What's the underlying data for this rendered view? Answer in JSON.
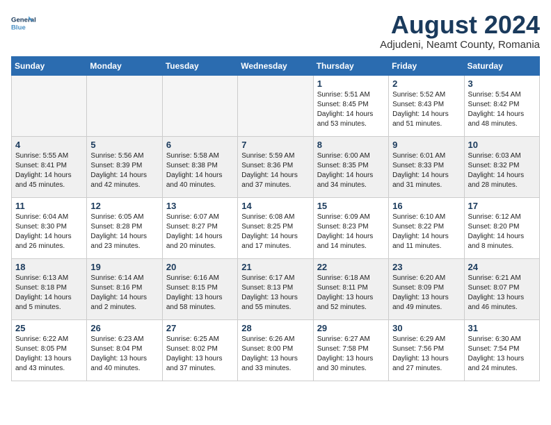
{
  "header": {
    "logo_line1": "General",
    "logo_line2": "Blue",
    "month_year": "August 2024",
    "location": "Adjudeni, Neamt County, Romania"
  },
  "days_of_week": [
    "Sunday",
    "Monday",
    "Tuesday",
    "Wednesday",
    "Thursday",
    "Friday",
    "Saturday"
  ],
  "weeks": [
    [
      {
        "day": "",
        "text": "",
        "empty": true
      },
      {
        "day": "",
        "text": "",
        "empty": true
      },
      {
        "day": "",
        "text": "",
        "empty": true
      },
      {
        "day": "",
        "text": "",
        "empty": true
      },
      {
        "day": "1",
        "text": "Sunrise: 5:51 AM\nSunset: 8:45 PM\nDaylight: 14 hours\nand 53 minutes."
      },
      {
        "day": "2",
        "text": "Sunrise: 5:52 AM\nSunset: 8:43 PM\nDaylight: 14 hours\nand 51 minutes."
      },
      {
        "day": "3",
        "text": "Sunrise: 5:54 AM\nSunset: 8:42 PM\nDaylight: 14 hours\nand 48 minutes."
      }
    ],
    [
      {
        "day": "4",
        "text": "Sunrise: 5:55 AM\nSunset: 8:41 PM\nDaylight: 14 hours\nand 45 minutes.",
        "shaded": true
      },
      {
        "day": "5",
        "text": "Sunrise: 5:56 AM\nSunset: 8:39 PM\nDaylight: 14 hours\nand 42 minutes.",
        "shaded": true
      },
      {
        "day": "6",
        "text": "Sunrise: 5:58 AM\nSunset: 8:38 PM\nDaylight: 14 hours\nand 40 minutes.",
        "shaded": true
      },
      {
        "day": "7",
        "text": "Sunrise: 5:59 AM\nSunset: 8:36 PM\nDaylight: 14 hours\nand 37 minutes.",
        "shaded": true
      },
      {
        "day": "8",
        "text": "Sunrise: 6:00 AM\nSunset: 8:35 PM\nDaylight: 14 hours\nand 34 minutes.",
        "shaded": true
      },
      {
        "day": "9",
        "text": "Sunrise: 6:01 AM\nSunset: 8:33 PM\nDaylight: 14 hours\nand 31 minutes.",
        "shaded": true
      },
      {
        "day": "10",
        "text": "Sunrise: 6:03 AM\nSunset: 8:32 PM\nDaylight: 14 hours\nand 28 minutes.",
        "shaded": true
      }
    ],
    [
      {
        "day": "11",
        "text": "Sunrise: 6:04 AM\nSunset: 8:30 PM\nDaylight: 14 hours\nand 26 minutes."
      },
      {
        "day": "12",
        "text": "Sunrise: 6:05 AM\nSunset: 8:28 PM\nDaylight: 14 hours\nand 23 minutes."
      },
      {
        "day": "13",
        "text": "Sunrise: 6:07 AM\nSunset: 8:27 PM\nDaylight: 14 hours\nand 20 minutes."
      },
      {
        "day": "14",
        "text": "Sunrise: 6:08 AM\nSunset: 8:25 PM\nDaylight: 14 hours\nand 17 minutes."
      },
      {
        "day": "15",
        "text": "Sunrise: 6:09 AM\nSunset: 8:23 PM\nDaylight: 14 hours\nand 14 minutes."
      },
      {
        "day": "16",
        "text": "Sunrise: 6:10 AM\nSunset: 8:22 PM\nDaylight: 14 hours\nand 11 minutes."
      },
      {
        "day": "17",
        "text": "Sunrise: 6:12 AM\nSunset: 8:20 PM\nDaylight: 14 hours\nand 8 minutes."
      }
    ],
    [
      {
        "day": "18",
        "text": "Sunrise: 6:13 AM\nSunset: 8:18 PM\nDaylight: 14 hours\nand 5 minutes.",
        "shaded": true
      },
      {
        "day": "19",
        "text": "Sunrise: 6:14 AM\nSunset: 8:16 PM\nDaylight: 14 hours\nand 2 minutes.",
        "shaded": true
      },
      {
        "day": "20",
        "text": "Sunrise: 6:16 AM\nSunset: 8:15 PM\nDaylight: 13 hours\nand 58 minutes.",
        "shaded": true
      },
      {
        "day": "21",
        "text": "Sunrise: 6:17 AM\nSunset: 8:13 PM\nDaylight: 13 hours\nand 55 minutes.",
        "shaded": true
      },
      {
        "day": "22",
        "text": "Sunrise: 6:18 AM\nSunset: 8:11 PM\nDaylight: 13 hours\nand 52 minutes.",
        "shaded": true
      },
      {
        "day": "23",
        "text": "Sunrise: 6:20 AM\nSunset: 8:09 PM\nDaylight: 13 hours\nand 49 minutes.",
        "shaded": true
      },
      {
        "day": "24",
        "text": "Sunrise: 6:21 AM\nSunset: 8:07 PM\nDaylight: 13 hours\nand 46 minutes.",
        "shaded": true
      }
    ],
    [
      {
        "day": "25",
        "text": "Sunrise: 6:22 AM\nSunset: 8:05 PM\nDaylight: 13 hours\nand 43 minutes."
      },
      {
        "day": "26",
        "text": "Sunrise: 6:23 AM\nSunset: 8:04 PM\nDaylight: 13 hours\nand 40 minutes."
      },
      {
        "day": "27",
        "text": "Sunrise: 6:25 AM\nSunset: 8:02 PM\nDaylight: 13 hours\nand 37 minutes."
      },
      {
        "day": "28",
        "text": "Sunrise: 6:26 AM\nSunset: 8:00 PM\nDaylight: 13 hours\nand 33 minutes."
      },
      {
        "day": "29",
        "text": "Sunrise: 6:27 AM\nSunset: 7:58 PM\nDaylight: 13 hours\nand 30 minutes."
      },
      {
        "day": "30",
        "text": "Sunrise: 6:29 AM\nSunset: 7:56 PM\nDaylight: 13 hours\nand 27 minutes."
      },
      {
        "day": "31",
        "text": "Sunrise: 6:30 AM\nSunset: 7:54 PM\nDaylight: 13 hours\nand 24 minutes."
      }
    ]
  ]
}
